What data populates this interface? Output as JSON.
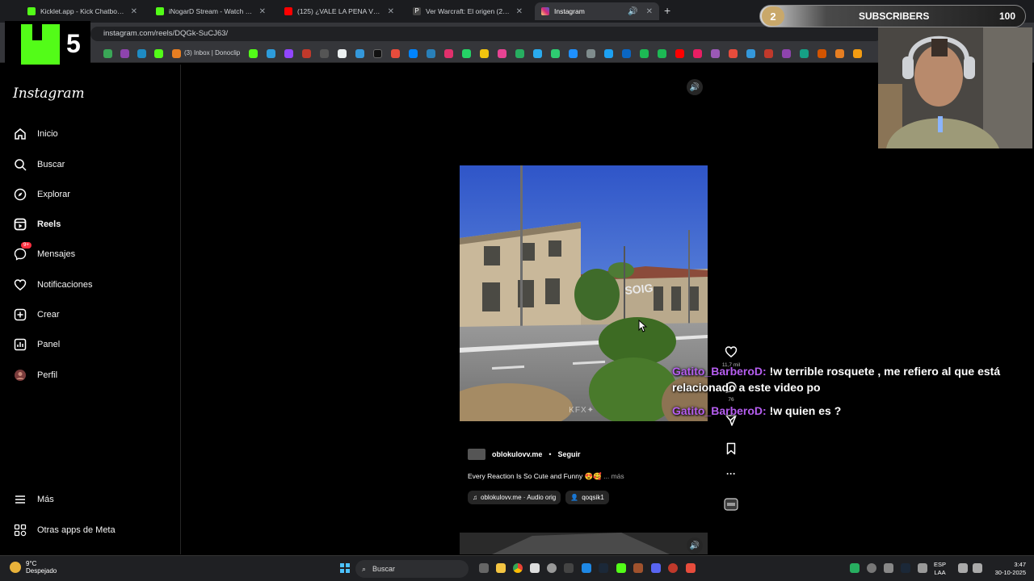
{
  "browser": {
    "tabs": [
      {
        "title": "Kicklet.app - Kick Chatbot and",
        "active": false,
        "color": "#53fc18"
      },
      {
        "title": "iNogarD Stream - Watch Live o",
        "active": false,
        "color": "#53fc18"
      },
      {
        "title": "(125) ¿VALE LA PENA VER GINT",
        "active": false,
        "color": "#ff0000"
      },
      {
        "title": "Ver Warcraft: El origen (2016) O",
        "active": false,
        "color": "#ffffff"
      },
      {
        "title": "Instagram",
        "active": true,
        "color": "#e1306c"
      }
    ],
    "url": "instagram.com/reels/DQGk-SuCJ63/",
    "bookmark_text": "(3) Inbox | Donoclip"
  },
  "overlay": {
    "kick_number": "5",
    "subscribers_label": "SUBSCRIBERS",
    "subscribers_current": "2",
    "subscribers_goal": "100"
  },
  "sidebar": {
    "logo": "Instagram",
    "items": [
      {
        "label": "Inicio",
        "icon": "home-icon"
      },
      {
        "label": "Buscar",
        "icon": "search-icon"
      },
      {
        "label": "Explorar",
        "icon": "compass-icon"
      },
      {
        "label": "Reels",
        "icon": "reels-icon"
      },
      {
        "label": "Mensajes",
        "icon": "messenger-icon",
        "badge": "9+"
      },
      {
        "label": "Notificaciones",
        "icon": "heart-icon"
      },
      {
        "label": "Crear",
        "icon": "plus-square-icon"
      },
      {
        "label": "Panel",
        "icon": "chart-icon"
      },
      {
        "label": "Perfil",
        "icon": "profile-icon"
      }
    ],
    "bottom": [
      {
        "label": "Más",
        "icon": "menu-icon"
      },
      {
        "label": "Otras apps de Meta",
        "icon": "meta-icon"
      }
    ]
  },
  "reel": {
    "username": "oblokulovv.me",
    "separator": "•",
    "follow": "Seguir",
    "caption": "Every Reaction Is So Cute and Funny 😍🥰",
    "more": "... más",
    "audio": "oblokulovv.me · Audio orig",
    "tag": "qoqsik1",
    "watermark": "KFX✦",
    "likes": "11,7 mil",
    "comments": "76"
  },
  "chat": [
    {
      "user": "Gatito_BarberoD:",
      "text": "!w terrible rosquete , me refiero al que está relacionado a este video po"
    },
    {
      "user": "Gatito_BarberoD:",
      "text": "!w quien es ?"
    }
  ],
  "taskbar": {
    "temp": "9°C",
    "weather": "Despejado",
    "search": "Buscar",
    "lang1": "ESP",
    "lang2": "LAA",
    "time": "3:47",
    "date": "30-10-2025"
  }
}
